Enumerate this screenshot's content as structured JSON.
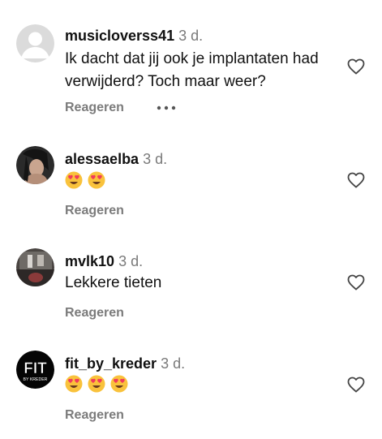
{
  "comments": [
    {
      "username": "musicloverss41",
      "time": "3 d.",
      "text": "Ik dacht dat jij ook je implantaten had verwijderd? Toch maar weer?",
      "reply_label": "Reageren",
      "avatar": "default-avatar-icon"
    },
    {
      "username": "alessaelba",
      "time": "3 d.",
      "emojis": [
        "heart-eyes-emoji",
        "heart-eyes-emoji"
      ],
      "reply_label": "Reageren",
      "avatar": "profile-photo"
    },
    {
      "username": "mvlk10",
      "time": "3 d.",
      "text": "Lekkere tieten",
      "reply_label": "Reageren",
      "avatar": "profile-photo"
    },
    {
      "username": "fit_by_kreder",
      "time": "3 d.",
      "emojis": [
        "heart-eyes-emoji",
        "heart-eyes-emoji",
        "heart-eyes-emoji"
      ],
      "reply_label": "Reageren",
      "avatar": "logo",
      "avatar_logo_text": "FIT",
      "avatar_logo_subtext": "BY KREDER"
    }
  ],
  "icons": {
    "like": "heart-outline-icon",
    "more": "more-options-icon"
  },
  "colors": {
    "text": "#111111",
    "secondary": "#7a7a7a",
    "background": "#ffffff"
  }
}
